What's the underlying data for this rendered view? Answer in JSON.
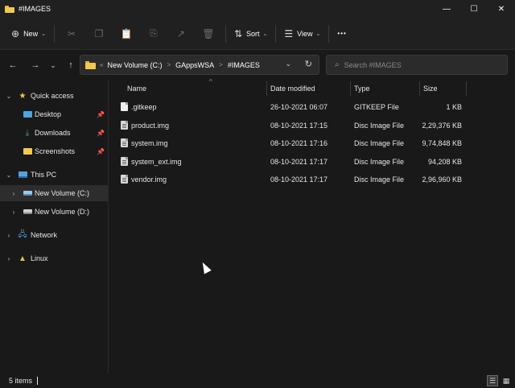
{
  "window": {
    "title": "#IMAGES",
    "controls": {
      "minimize": "—",
      "maximize": "☐",
      "close": "✕"
    }
  },
  "command_bar": {
    "new_label": "New",
    "sort_label": "Sort",
    "view_label": "View",
    "more_label": "•••",
    "icons": [
      "cut-icon",
      "copy-icon",
      "paste-icon",
      "rename-icon",
      "share-icon",
      "delete-icon"
    ]
  },
  "address": {
    "overflow": "«",
    "crumbs": [
      "New Volume (C:)",
      "GAppsWSA",
      "#IMAGES"
    ],
    "separator": ">"
  },
  "search": {
    "placeholder": "Search #IMAGES"
  },
  "sidebar": {
    "items": [
      {
        "label": "Quick access",
        "icon": "star-icon",
        "color": "#f2c94c"
      },
      {
        "label": "Desktop",
        "icon": "desktop-icon",
        "color": "#4fa3e0",
        "pinned": true
      },
      {
        "label": "Downloads",
        "icon": "download-icon",
        "color": "#3fb58a",
        "pinned": true
      },
      {
        "label": "Screenshots",
        "icon": "folder-icon",
        "color": "#f2c94c",
        "pinned": true
      },
      {
        "label": "This PC",
        "icon": "computer-icon",
        "color": "#4fa3e0"
      },
      {
        "label": "New Volume (C:)",
        "icon": "drive-icon",
        "color": "#9ec7e8",
        "selected": true
      },
      {
        "label": "New Volume (D:)",
        "icon": "drive-icon",
        "color": "#cfcfcf"
      },
      {
        "label": "Network",
        "icon": "network-icon",
        "color": "#4fa3e0"
      },
      {
        "label": "Linux",
        "icon": "linux-icon",
        "color": "#e8c040"
      }
    ]
  },
  "columns": {
    "name": "Name",
    "date": "Date modified",
    "type": "Type",
    "size": "Size"
  },
  "files": [
    {
      "name": ".gitkeep",
      "date": "26-10-2021 06:07",
      "type": "GITKEEP File",
      "size": "1 KB"
    },
    {
      "name": "product.img",
      "date": "08-10-2021 17:15",
      "type": "Disc Image File",
      "size": "2,29,376 KB"
    },
    {
      "name": "system.img",
      "date": "08-10-2021 17:16",
      "type": "Disc Image File",
      "size": "9,74,848 KB"
    },
    {
      "name": "system_ext.img",
      "date": "08-10-2021 17:17",
      "type": "Disc Image File",
      "size": "94,208 KB"
    },
    {
      "name": "vendor.img",
      "date": "08-10-2021 17:17",
      "type": "Disc Image File",
      "size": "2,96,960 KB"
    }
  ],
  "status": {
    "item_count": "5 items"
  }
}
